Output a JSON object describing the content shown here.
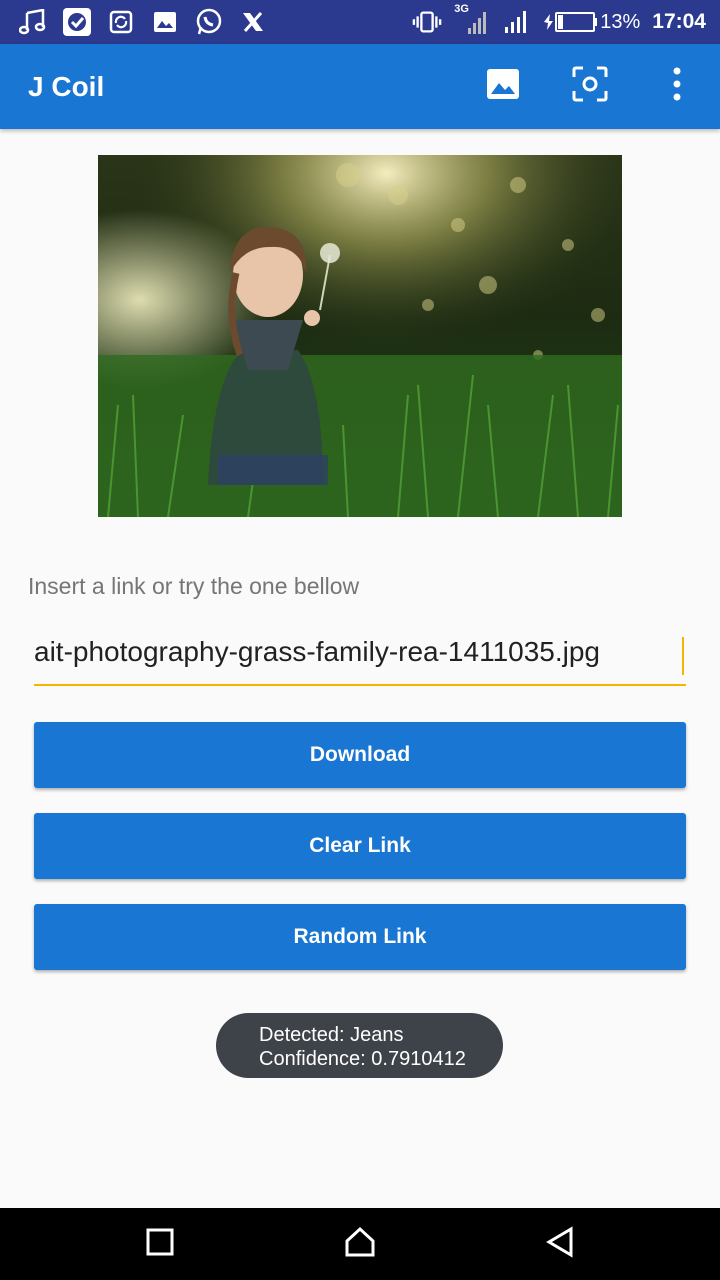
{
  "status_bar": {
    "left_icons": [
      "music-icon",
      "vpn-shield-icon",
      "sync-icon",
      "image-icon",
      "whatsapp-icon",
      "x-icon"
    ],
    "network_label": "3G",
    "battery": "13%",
    "time": "17:04"
  },
  "app_bar": {
    "title": "J Coil",
    "actions": [
      "gallery-image-icon",
      "camera-scan-icon",
      "more-vert-icon"
    ]
  },
  "main": {
    "hint": "Insert a link or try the one bellow",
    "link_value": "ait-photography-grass-family-rea-1411035.jpg",
    "buttons": {
      "download": "Download",
      "clear": "Clear Link",
      "random": "Random Link"
    }
  },
  "toast": {
    "line1": "Detected: Jeans",
    "line2": "Confidence: 0.7910412"
  },
  "nav": [
    "recent-apps-icon",
    "home-icon",
    "back-icon"
  ],
  "colors": {
    "status_bar": "#2b3a8f",
    "primary": "#1976d2",
    "accent": "#f4b400",
    "toast": "#3e4249"
  }
}
